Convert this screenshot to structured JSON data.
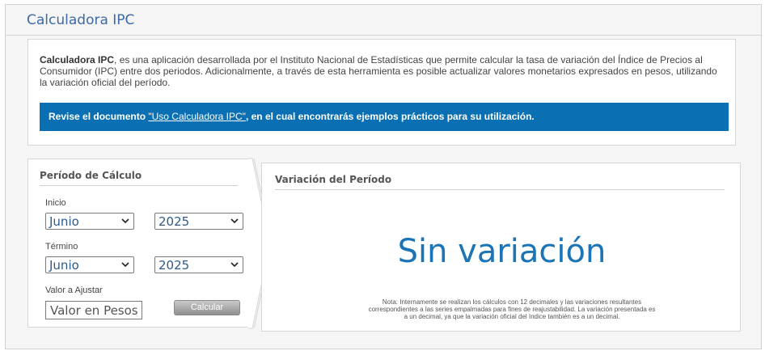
{
  "header": {
    "title": "Calculadora IPC"
  },
  "intro": {
    "app_name": "Calculadora IPC",
    "description": ", es una aplicación desarrollada por el Instituto Nacional de Estadísticas que permite calcular la tasa de variación del Índice de Precios al Consumidor (IPC) entre dos periodos. Adicionalmente, a través de esta herramienta es posible actualizar valores monetarios expresados en pesos, utilizando la variación oficial del período."
  },
  "banner": {
    "prefix": "Revise el documento ",
    "link": "\"Uso Calculadora IPC\"",
    "suffix": ", en el cual encontrarás ejemplos prácticos para su utilización.",
    "color": "#0a6fb3"
  },
  "calc": {
    "heading": "Período de Cálculo",
    "start_label": "Inicio",
    "start_month": "Junio",
    "start_year": "2025",
    "end_label": "Término",
    "end_month": "Junio",
    "end_year": "2025",
    "amount_label": "Valor a Ajustar",
    "amount_placeholder": "Valor en Pesos",
    "button_label": "Calcular"
  },
  "result": {
    "heading": "Variación del Período",
    "value": "Sin variación",
    "note": "Nota: Internamente se realizan los cálculos con 12 decimales y las variaciones resultantes correspondientes a las series empalmadas para fines de reajustabilidad. La variación presentada es a un decimal, ya que la variación oficial del índice también es a un decimal.",
    "color": "#1b74b6"
  },
  "icons": {
    "select_arrow": "chevron-down-icon",
    "panel_arrow": "chevron-right-icon"
  }
}
